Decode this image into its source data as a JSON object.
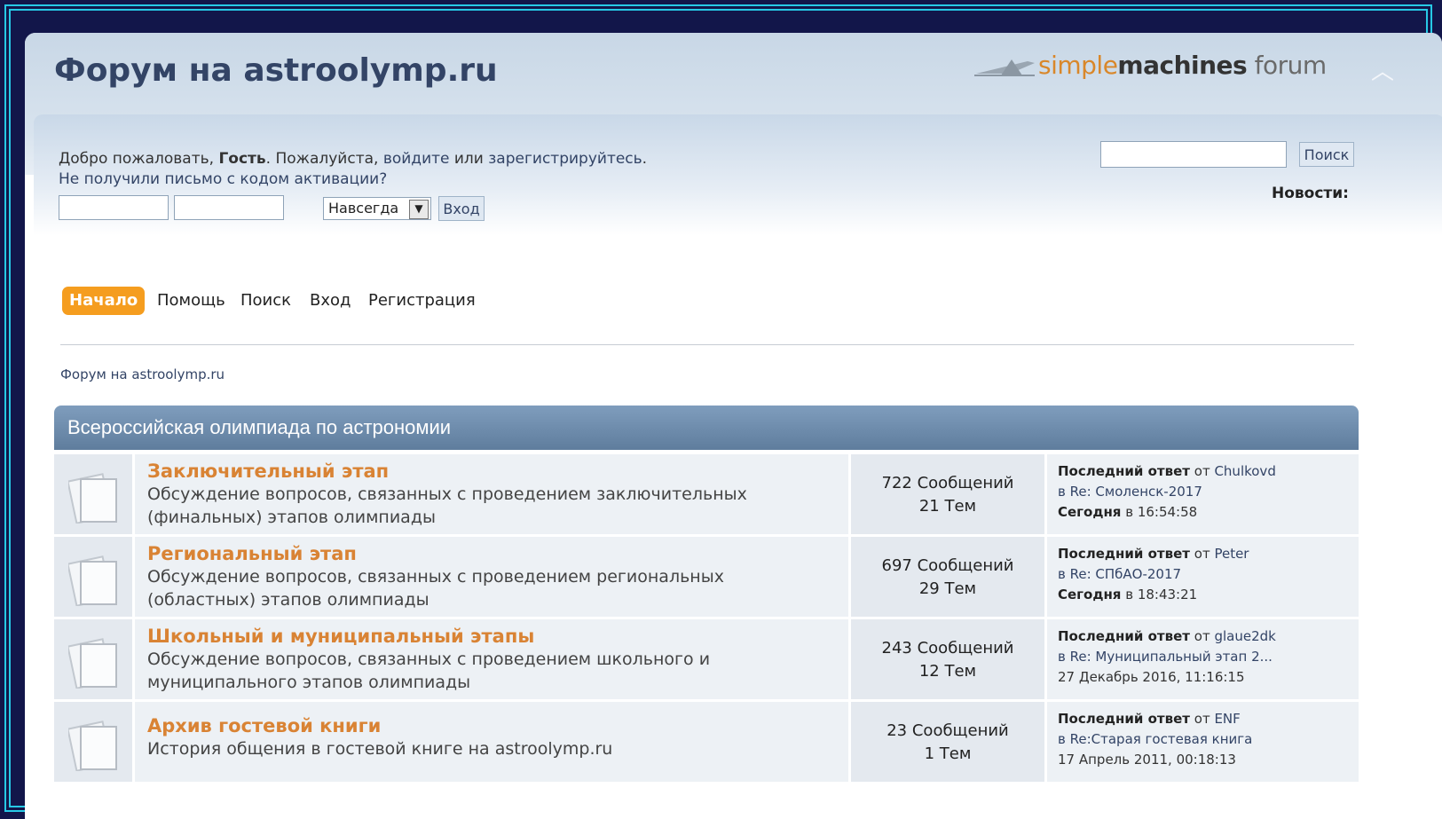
{
  "header": {
    "site_title": "Форум на astroolymp.ru",
    "logo_simple": "simple",
    "logo_machines": "machines",
    "logo_forum": " forum"
  },
  "user_panel": {
    "greet_prefix": "Добро пожаловать, ",
    "guest": "Гость",
    "greet_mid": ". Пожалуйста, ",
    "login_link": "войдите",
    "greet_or": " или ",
    "register_link": "зарегистрируйтесь",
    "greet_end": ".",
    "activation_link": "Не получили письмо с кодом активации?",
    "duration_selected": "Навсегда",
    "login_button": "Вход",
    "search_button": "Поиск",
    "news_label": "Новости:"
  },
  "nav": {
    "items": [
      "Начало",
      "Помощь",
      "Поиск",
      "Вход",
      "Регистрация"
    ]
  },
  "breadcrumb": "Форум на astroolymp.ru",
  "category": {
    "title": "Всероссийская олимпиада по астрономии",
    "boards": [
      {
        "name": "Заключительный этап",
        "desc1": "Обсуждение вопросов, связанных с проведением заключительных",
        "desc2": "(финальных) этапов олимпиады",
        "posts": "722 Сообщений",
        "topics": "21 Тем",
        "last_label": "Последний ответ",
        "by": " от ",
        "author": "Chulkovd",
        "in": "в ",
        "topic": "Re: Смоленск-2017",
        "date_bold": "Сегодня",
        "date_rest": " в 16:54:58"
      },
      {
        "name": "Региональный этап",
        "desc1": "Обсуждение вопросов, связанных с проведением региональных",
        "desc2": "(областных) этапов олимпиады",
        "posts": "697 Сообщений",
        "topics": "29 Тем",
        "last_label": "Последний ответ",
        "by": " от ",
        "author": "Peter",
        "in": "в ",
        "topic": "Re: СПбАО-2017",
        "date_bold": "Сегодня",
        "date_rest": " в 18:43:21"
      },
      {
        "name": "Школьный и муниципальный этапы",
        "desc1": "Обсуждение вопросов, связанных с проведением школьного и",
        "desc2": "муниципального этапов олимпиады",
        "posts": "243 Сообщений",
        "topics": "12 Тем",
        "last_label": "Последний ответ",
        "by": " от ",
        "author": "glaue2dk",
        "in": "в ",
        "topic": "Re: Муниципальный этап 2...",
        "date_bold": "",
        "date_rest": "27 Декабрь 2016, 11:16:15"
      },
      {
        "name": "Архив гостевой книги",
        "desc1": "История общения в гостевой книге на astroolymp.ru",
        "desc2": "",
        "posts": "23 Сообщений",
        "topics": "1 Тем",
        "last_label": "Последний ответ",
        "by": " от ",
        "author": "ENF",
        "in": "в ",
        "topic": "Re:Старая гостевая книга",
        "date_bold": "",
        "date_rest": "17 Апрель 2011, 00:18:13"
      }
    ]
  }
}
